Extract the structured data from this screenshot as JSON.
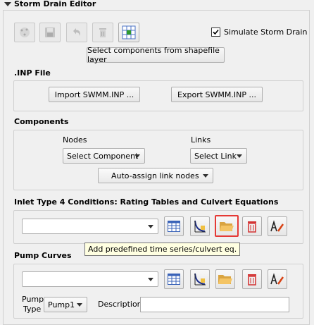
{
  "panel": {
    "title": "Storm Drain Editor"
  },
  "toolbar": {
    "simulate_label": "Simulate Storm Drain",
    "simulate_checked": true,
    "select_shapefile_label": "Select components from shapefile layer"
  },
  "inp": {
    "title": ".INP File",
    "import_label": "Import SWMM.INP ...",
    "export_label": "Export SWMM.INP ..."
  },
  "components": {
    "title": "Components",
    "nodes_label": "Nodes",
    "links_label": "Links",
    "nodes_value": "Select Component",
    "links_value": "Select Link",
    "auto_assign_label": "Auto-assign link nodes"
  },
  "inlet": {
    "title": "Inlet Type 4 Conditions: Rating Tables and Culvert Equations",
    "combo_value": "",
    "tooltip": "Add predefined time series/culvert eq."
  },
  "pump": {
    "title": "Pump Curves",
    "combo_value": "",
    "pump_type_label": "Pump\nType",
    "pump_type_line1": "Pump",
    "pump_type_line2": "Type",
    "pump_type_value": "Pump1",
    "description_label": "Description",
    "description_value": ""
  }
}
